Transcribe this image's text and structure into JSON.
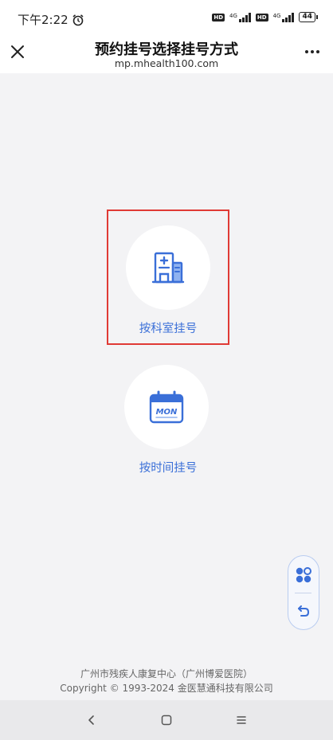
{
  "status_bar": {
    "time": "下午2:22",
    "network_1": "4G",
    "network_2": "4G",
    "battery": "44"
  },
  "header": {
    "title": "预约挂号选择挂号方式",
    "url": "mp.mhealth100.com"
  },
  "options": [
    {
      "label": "按科室挂号",
      "icon": "hospital-building-icon"
    },
    {
      "label": "按时间挂号",
      "icon": "calendar-icon",
      "calendar_text": "MON"
    }
  ],
  "footer": {
    "line1": "广州市残疾人康复中心（广州博爱医院）",
    "line2": "Copyright © 1993-2024 金医慧通科技有限公司"
  },
  "colors": {
    "accent": "#3a6fd8",
    "selection_border": "#e03a35",
    "background": "#f3f3f5"
  }
}
